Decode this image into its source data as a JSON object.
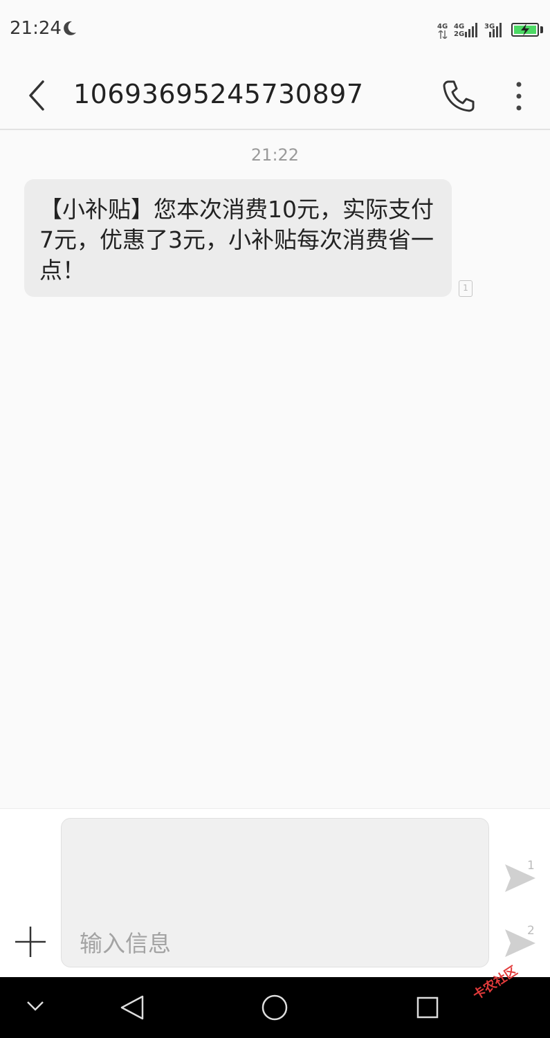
{
  "status_bar": {
    "time": "21:24",
    "sim1_label": "4G",
    "sim2_label_top": "4G",
    "sim2_label_bottom": "2G",
    "sim3_label": "3G",
    "icons": [
      "moon-icon",
      "signal-icon",
      "battery-charging-icon"
    ],
    "battery_color": "#4cd964"
  },
  "header": {
    "contact": "10693695245730897",
    "icons": [
      "back-arrow-icon",
      "phone-icon",
      "more-vertical-icon"
    ]
  },
  "conversation": {
    "timestamp": "21:22",
    "messages": [
      {
        "text": "【小补贴】您本次消费10元，实际支付7元，优惠了3元，小补贴每次消费省一点！",
        "sim_tag": "1"
      }
    ]
  },
  "compose": {
    "placeholder": "输入信息",
    "send1_badge": "1",
    "send2_badge": "2",
    "icons": [
      "plus-icon",
      "send-icon"
    ]
  },
  "nav_bar": {
    "icons": [
      "chevron-down-icon",
      "back-triangle-icon",
      "home-circle-icon",
      "recents-square-icon"
    ]
  },
  "watermark": "卡农社区"
}
